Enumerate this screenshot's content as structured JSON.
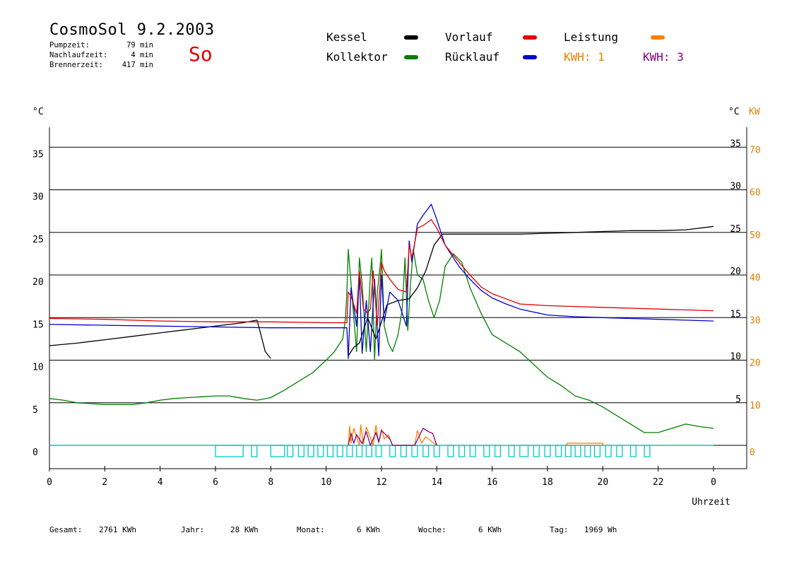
{
  "header": {
    "title": "CosmoSol 9.2.2003",
    "day": "So",
    "stats": [
      {
        "label": "Pumpzeit:",
        "value": "79 min"
      },
      {
        "label": "Nachlaufzeit:",
        "value": "4 min"
      },
      {
        "label": "Brennerzeit:",
        "value": "417 min"
      }
    ]
  },
  "legend": {
    "kessel": "Kessel",
    "vorlauf": "Vorlauf",
    "leistung": "Leistung",
    "kollektor": "Kollektor",
    "ruecklauf": "Rücklauf",
    "kwh1": "KWH: 1",
    "kwh3": "KWH: 3"
  },
  "colors": {
    "kessel": "#000000",
    "vorlauf": "#e00000",
    "leistung": "#ff8000",
    "kollektor": "#008000",
    "ruecklauf": "#0000d0",
    "kwh1": "#e08000",
    "kwh3": "#800080",
    "pump": "#00c8c8",
    "kw_axis": "#e08000"
  },
  "footer": [
    {
      "label": "Gesamt:",
      "value": "2761 KWh"
    },
    {
      "label": "Jahr:",
      "value": "28 KWh"
    },
    {
      "label": "Monat:",
      "value": "6 KWh"
    },
    {
      "label": "Woche:",
      "value": "6 KWh"
    },
    {
      "label": "Tag:",
      "value": "1969 Wh"
    }
  ],
  "chart_data": {
    "type": "line",
    "xlabel": "Uhrzeit",
    "ylabel_left": "°C",
    "ylabel_right": "°C KW",
    "xlim": [
      0,
      24
    ],
    "ylim": [
      -2.7,
      37.5
    ],
    "x_ticks": [
      "0",
      "2",
      "4",
      "6",
      "8",
      "10",
      "12",
      "14",
      "16",
      "18",
      "20",
      "22",
      "0"
    ],
    "y_ticks_left": [
      "0",
      "5",
      "10",
      "15",
      "20",
      "25",
      "30",
      "35"
    ],
    "y_ticks_right": [
      "5",
      "10",
      "15",
      "20",
      "25",
      "30",
      "35"
    ],
    "y_ticks_kw": [
      "0",
      "10",
      "20",
      "30",
      "40",
      "50",
      "60",
      "70"
    ],
    "grid": "horizontal",
    "series": [
      {
        "name": "Kessel",
        "key": "kessel",
        "x": [
          0,
          1,
          2,
          3,
          4,
          5,
          6,
          7,
          7.5,
          7.6,
          7.8,
          8.0,
          null,
          10.8,
          11.0,
          11.2,
          11.5,
          11.8,
          12.2,
          12.6,
          13.0,
          13.3,
          13.6,
          13.9,
          14.2,
          15,
          16,
          17,
          18,
          19,
          20,
          21,
          22,
          23,
          24
        ],
        "y": [
          11.7,
          12.0,
          12.4,
          12.8,
          13.2,
          13.6,
          14.0,
          14.4,
          14.7,
          13.5,
          11.0,
          10.2,
          null,
          10.5,
          11.5,
          12.0,
          15.0,
          12.5,
          16.5,
          17.0,
          17.2,
          18.5,
          20.5,
          23.5,
          24.8,
          24.8,
          24.8,
          24.8,
          24.9,
          25.0,
          25.1,
          25.2,
          25.2,
          25.3,
          25.7
        ]
      },
      {
        "name": "Vorlauf",
        "key": "vorlauf",
        "x": [
          0,
          2,
          4,
          6,
          8,
          10,
          10.75,
          10.8,
          10.9,
          11.1,
          11.2,
          11.35,
          11.5,
          11.6,
          11.7,
          11.85,
          11.9,
          12.0,
          12.1,
          12.3,
          12.6,
          12.9,
          13.0,
          13.1,
          13.3,
          13.5,
          13.8,
          14.0,
          14.3,
          14.8,
          15.2,
          15.6,
          16,
          16.5,
          17,
          18,
          19,
          20,
          21,
          22,
          23,
          24
        ],
        "y": [
          14.9,
          14.8,
          14.6,
          14.5,
          14.5,
          14.4,
          14.4,
          18.0,
          17.5,
          15.5,
          20.5,
          16.0,
          15.5,
          16.0,
          20.5,
          14.0,
          16.5,
          21.5,
          20.5,
          19.5,
          18.3,
          18.0,
          23.5,
          22.0,
          25.5,
          25.8,
          26.5,
          25.5,
          23.5,
          21.5,
          20.0,
          18.6,
          17.8,
          17.2,
          16.6,
          16.4,
          16.3,
          16.2,
          16.1,
          16.0,
          15.9,
          15.8
        ]
      },
      {
        "name": "Rücklauf",
        "key": "ruecklauf",
        "x": [
          0,
          2,
          4,
          6,
          8,
          10,
          10.75,
          10.8,
          10.9,
          11.1,
          11.2,
          11.3,
          11.45,
          11.6,
          11.75,
          11.9,
          12.0,
          12.1,
          12.3,
          12.6,
          12.9,
          13.0,
          13.1,
          13.3,
          13.5,
          13.8,
          14.0,
          14.3,
          14.8,
          15.2,
          15.6,
          16,
          16.5,
          17,
          18,
          19,
          20,
          21,
          22,
          23,
          24
        ],
        "y": [
          14.2,
          14.1,
          14.0,
          13.9,
          13.8,
          13.8,
          13.8,
          10.2,
          18.5,
          14.0,
          20.0,
          10.8,
          17.0,
          11.0,
          19.5,
          10.5,
          20.0,
          14.5,
          18.0,
          17.0,
          14.0,
          24.0,
          21.5,
          26.0,
          27.0,
          28.3,
          26.5,
          23.5,
          21.0,
          19.5,
          18.2,
          17.3,
          16.6,
          16.0,
          15.3,
          15.1,
          15.0,
          14.9,
          14.8,
          14.7,
          14.6
        ]
      },
      {
        "name": "Kollektor",
        "key": "kollektor",
        "x": [
          0,
          0.5,
          1,
          1.5,
          2,
          2.5,
          3,
          3.5,
          4,
          4.5,
          5,
          5.5,
          6,
          6.5,
          7,
          7.5,
          8,
          8.5,
          9,
          9.5,
          10,
          10.3,
          10.6,
          10.7,
          10.75,
          10.8,
          11.0,
          11.1,
          11.2,
          11.3,
          11.45,
          11.6,
          11.65,
          11.75,
          11.85,
          11.95,
          12.0,
          12.1,
          12.25,
          12.4,
          12.6,
          12.75,
          12.85,
          12.95,
          13.05,
          13.15,
          13.3,
          13.5,
          13.7,
          13.9,
          14.1,
          14.3,
          14.6,
          14.9,
          15.2,
          15.6,
          16,
          16.5,
          17,
          17.5,
          18,
          18.5,
          19,
          19.5,
          20,
          20.5,
          21,
          21.5,
          22,
          22.5,
          23,
          23.5,
          24
        ],
        "y": [
          5.5,
          5.3,
          5.0,
          4.9,
          4.8,
          4.8,
          4.8,
          5.0,
          5.3,
          5.5,
          5.6,
          5.7,
          5.8,
          5.8,
          5.5,
          5.3,
          5.6,
          6.5,
          7.5,
          8.5,
          10.0,
          11.0,
          12.5,
          15.0,
          18.0,
          23.0,
          15.0,
          11.0,
          22.0,
          19.0,
          11.0,
          20.0,
          22.0,
          10.0,
          18.0,
          21.0,
          23.0,
          14.0,
          12.0,
          11.0,
          13.0,
          16.0,
          22.0,
          13.5,
          19.0,
          23.0,
          20.0,
          19.5,
          17.0,
          15.0,
          17.0,
          21.0,
          22.5,
          21.5,
          18.5,
          15.5,
          13.0,
          12.0,
          11.0,
          9.5,
          8.0,
          7.0,
          5.8,
          5.3,
          4.5,
          3.5,
          2.5,
          1.5,
          1.5,
          2.0,
          2.5,
          2.2,
          2.0
        ]
      },
      {
        "name": "Leistung",
        "key": "leistung",
        "unit": "KW",
        "x": [
          10.8,
          10.85,
          10.9,
          11.0,
          11.2,
          11.25,
          11.35,
          11.45,
          11.7,
          11.8,
          11.9,
          12.0,
          12.1,
          12.25,
          12.4,
          13.2,
          13.3,
          13.45,
          13.6,
          14.0
        ],
        "y": [
          0,
          4.5,
          0.5,
          4.0,
          0,
          4.8,
          0.3,
          4.3,
          0,
          4.7,
          0.5,
          3.8,
          1.5,
          2.5,
          0,
          0,
          3.5,
          0.5,
          2.0,
          0
        ]
      },
      {
        "name": "KWH: 3",
        "key": "kwh3",
        "unit": "KW",
        "x": [
          10.8,
          10.9,
          11.0,
          11.1,
          11.3,
          11.45,
          11.6,
          11.8,
          11.9,
          12.0,
          12.15,
          12.3,
          12.4,
          13.2,
          13.35,
          13.5,
          13.7,
          13.85,
          14.0
        ],
        "y": [
          0,
          2.8,
          0.5,
          2.5,
          0.4,
          3.2,
          0,
          3.0,
          0.8,
          3.5,
          2.5,
          1.5,
          0,
          0,
          2.0,
          4.0,
          3.2,
          2.8,
          0
        ]
      }
    ],
    "pump_on_intervals": [
      [
        6.0,
        7.0
      ],
      [
        7.3,
        7.5
      ],
      [
        8.0,
        8.5
      ],
      [
        8.6,
        8.8
      ],
      [
        9.0,
        9.2
      ],
      [
        9.35,
        9.55
      ],
      [
        9.7,
        9.9
      ],
      [
        10.05,
        10.25
      ],
      [
        10.4,
        10.6
      ],
      [
        10.75,
        10.95
      ],
      [
        11.1,
        11.3
      ],
      [
        11.45,
        11.65
      ],
      [
        11.8,
        12.0
      ],
      [
        12.3,
        12.5
      ],
      [
        12.7,
        12.9
      ],
      [
        13.1,
        13.3
      ],
      [
        13.5,
        13.7
      ],
      [
        13.9,
        14.1
      ],
      [
        14.4,
        14.6
      ],
      [
        14.8,
        15.0
      ],
      [
        15.2,
        15.4
      ],
      [
        15.7,
        15.9
      ],
      [
        16.1,
        16.3
      ],
      [
        16.6,
        16.8
      ],
      [
        17.0,
        17.3
      ],
      [
        17.5,
        17.7
      ],
      [
        17.9,
        18.1
      ],
      [
        18.3,
        18.5
      ],
      [
        18.65,
        18.85
      ],
      [
        19.0,
        19.2
      ],
      [
        19.35,
        19.55
      ],
      [
        19.7,
        19.9
      ],
      [
        20.1,
        20.3
      ],
      [
        20.5,
        20.7
      ],
      [
        21.0,
        21.2
      ],
      [
        21.5,
        21.7
      ]
    ],
    "kwh1_intervals": [
      [
        18.7,
        20.0
      ]
    ]
  }
}
